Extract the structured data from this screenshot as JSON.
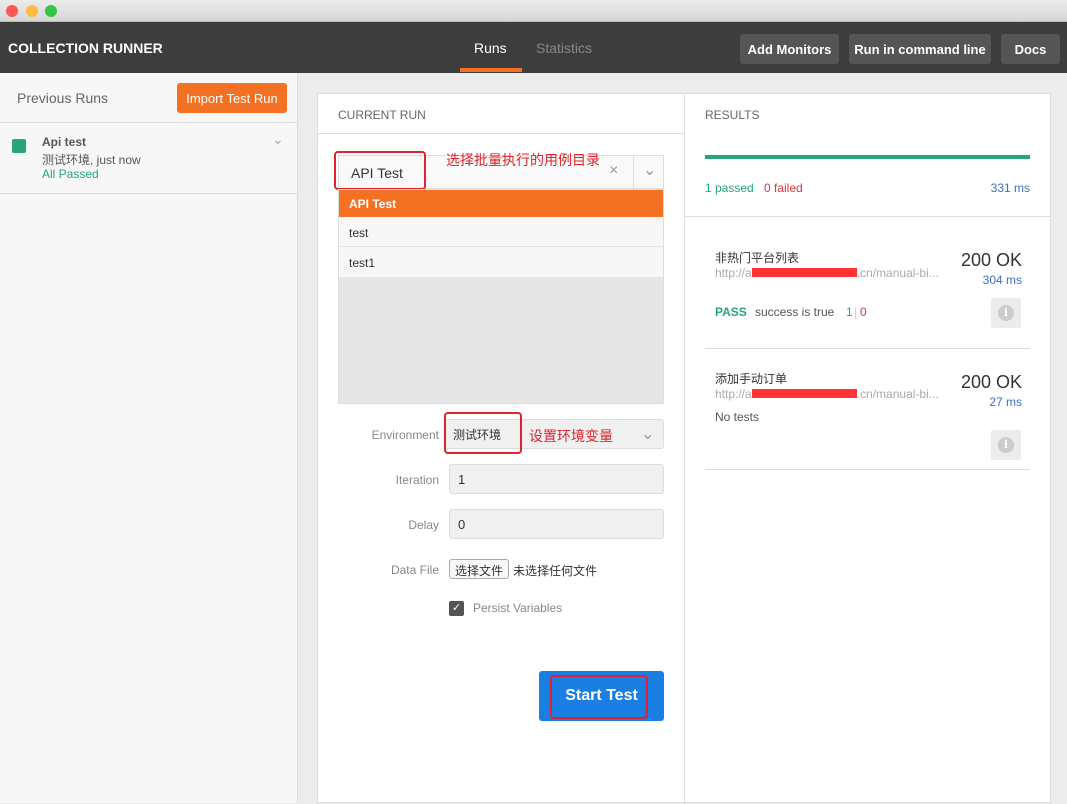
{
  "header": {
    "title": "COLLECTION RUNNER",
    "tabs": [
      {
        "label": "Runs",
        "active": true
      },
      {
        "label": "Statistics",
        "active": false
      }
    ],
    "buttons": [
      "Add Monitors",
      "Run in command line",
      "Docs"
    ]
  },
  "sidebar": {
    "title": "Previous Runs",
    "import_button": "Import Test Run",
    "runs": [
      {
        "name": "Api test",
        "subtitle": "测试环境, just now",
        "status": "All Passed"
      }
    ]
  },
  "current_run": {
    "heading": "CURRENT RUN",
    "collection_value": "API Test",
    "annotation_collection": "选择批量执行的用例目录",
    "options": [
      "API Test",
      "test",
      "test1"
    ],
    "environment_label": "Environment",
    "environment_value": "测试环境",
    "annotation_env": "设置环境变量",
    "iteration_label": "Iteration",
    "iteration_value": "1",
    "delay_label": "Delay",
    "delay_value": "0",
    "datafile_label": "Data File",
    "choose_file": "选择文件",
    "no_file": "未选择任何文件",
    "persist_label": "Persist Variables",
    "persist_checked": true,
    "start_button": "Start Test"
  },
  "results": {
    "heading": "RESULTS",
    "progress": 1.0,
    "passed": "1 passed",
    "failed": "0 failed",
    "total_time": "331 ms",
    "items": [
      {
        "name": "非热门平台列表",
        "url_prefix": "http://a",
        "url_suffix": ".cn/manual-bi...",
        "status": "200 OK",
        "time": "304 ms",
        "test_result": "PASS",
        "test_name": "success is true",
        "pass_count": "1",
        "fail_count": "0"
      },
      {
        "name": "添加手动订单",
        "url_prefix": "http://a",
        "url_suffix": ".cn/manual-bi...",
        "status": "200 OK",
        "time": "27 ms",
        "no_tests": "No tests"
      }
    ]
  },
  "colors": {
    "accent": "#f47023",
    "pass": "#26a67a",
    "fail": "#d9363e",
    "link": "#3d6fc4",
    "primary": "#1a7ee3",
    "annotation": "#e0232e"
  }
}
